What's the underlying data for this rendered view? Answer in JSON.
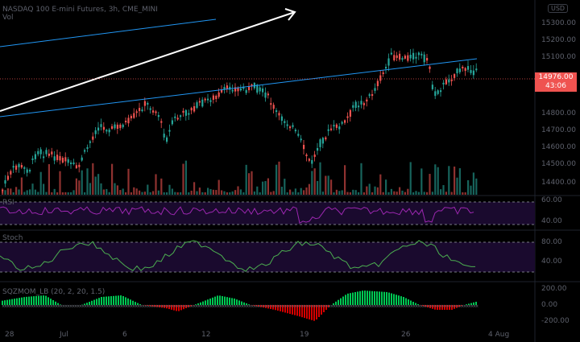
{
  "symbol": {
    "title": "NASDAQ 100 E-mini Futures, 3h, CME_MINI",
    "volume_label": "Vol"
  },
  "currency": "USD",
  "price_axis": {
    "ticks": [
      "15300.00",
      "15200.00",
      "15100.00",
      "14976.00",
      "14800.00",
      "14700.00",
      "14600.00",
      "14500.00",
      "14400.00"
    ]
  },
  "last_price": {
    "value": "14976.00",
    "countdown": "43:06"
  },
  "rsi_panel": {
    "label": "RSI",
    "levels": [
      "60.00",
      "40.00"
    ]
  },
  "stoch_panel": {
    "label": "Stoch",
    "levels": [
      "80.00",
      "40.00"
    ]
  },
  "sqz_panel": {
    "label": "SQZMOM_LB (20, 2, 20, 1.5)",
    "levels": [
      "200.00",
      "0.00",
      "-200.00"
    ]
  },
  "time_axis": {
    "labels": [
      "28",
      "Jul",
      "6",
      "12",
      "19",
      "26",
      "4 Aug"
    ]
  },
  "colors": {
    "up": "#26a69a",
    "down": "#ef5350",
    "trendline": "#2196f3",
    "arrow": "#ffffff",
    "rsi": "#9c27b0",
    "stoch": "#4caf50",
    "sqz_up": "#00c853",
    "sqz_down": "#d50000",
    "band_fill": "#1a0a2e"
  }
}
